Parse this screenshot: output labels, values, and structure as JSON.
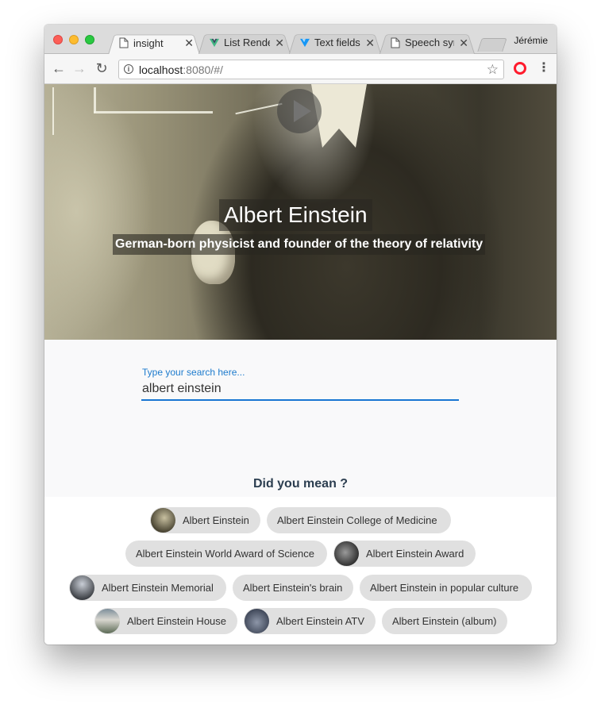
{
  "browser": {
    "profile_name": "Jérémie",
    "tabs": [
      {
        "title": "insight",
        "close": "✕"
      },
      {
        "title": "List Rendering",
        "close": "✕"
      },
      {
        "title": "Text fields",
        "close": "✕"
      },
      {
        "title": "Speech synthesis",
        "close": "✕"
      }
    ],
    "url_host": "localhost",
    "url_path": ":8080/#/",
    "icons": {
      "back": "arrow-left-icon",
      "forward": "arrow-right-icon",
      "reload": "reload-icon",
      "info": "info-icon",
      "bookmark": "star-icon",
      "opera": "opera-icon",
      "menu": "menu-icon"
    }
  },
  "hero": {
    "title": "Albert Einstein",
    "subtitle": "German-born physicist and founder of the theory of relativity",
    "play_icon": "play-icon"
  },
  "search": {
    "label": "Type your search here...",
    "value": "albert einstein"
  },
  "suggestions": {
    "title": "Did you mean ?",
    "chips": [
      {
        "label": "Albert Einstein",
        "avatar": true
      },
      {
        "label": "Albert Einstein College of Medicine",
        "avatar": false
      },
      {
        "label": "Albert Einstein World Award of Science",
        "avatar": false
      },
      {
        "label": "Albert Einstein Award",
        "avatar": true
      },
      {
        "label": "Albert Einstein Memorial",
        "avatar": true
      },
      {
        "label": "Albert Einstein's brain",
        "avatar": false
      },
      {
        "label": "Albert Einstein in popular culture",
        "avatar": false
      },
      {
        "label": "Albert Einstein House",
        "avatar": true
      },
      {
        "label": "Albert Einstein ATV",
        "avatar": true
      },
      {
        "label": "Albert Einstein (album)",
        "avatar": false
      }
    ]
  },
  "colors": {
    "accent": "#1976d2",
    "chip_bg": "#e0e0e0",
    "heading": "#2c3e50"
  }
}
